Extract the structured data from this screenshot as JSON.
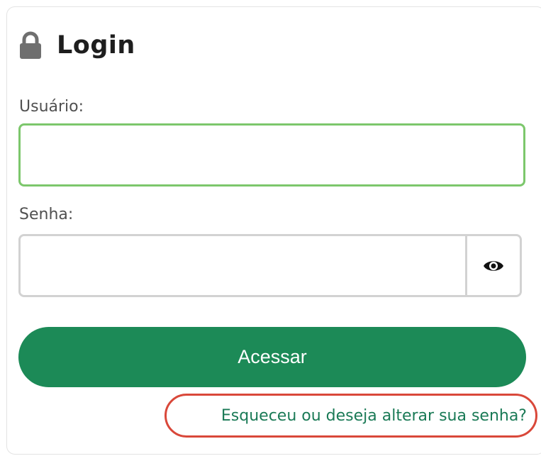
{
  "header": {
    "title": "Login",
    "icon": "lock-icon"
  },
  "form": {
    "username_label": "Usuário:",
    "username_value": "",
    "password_label": "Senha:",
    "password_value": "",
    "show_password_icon": "eye-icon",
    "submit_label": "Acessar",
    "forgot_link": "Esqueceu ou deseja alterar sua senha?"
  },
  "colors": {
    "primary": "#1c8a57",
    "input_focus_border": "#7cc76c",
    "link": "#1a7a56",
    "highlight_outline": "#d9483a"
  }
}
